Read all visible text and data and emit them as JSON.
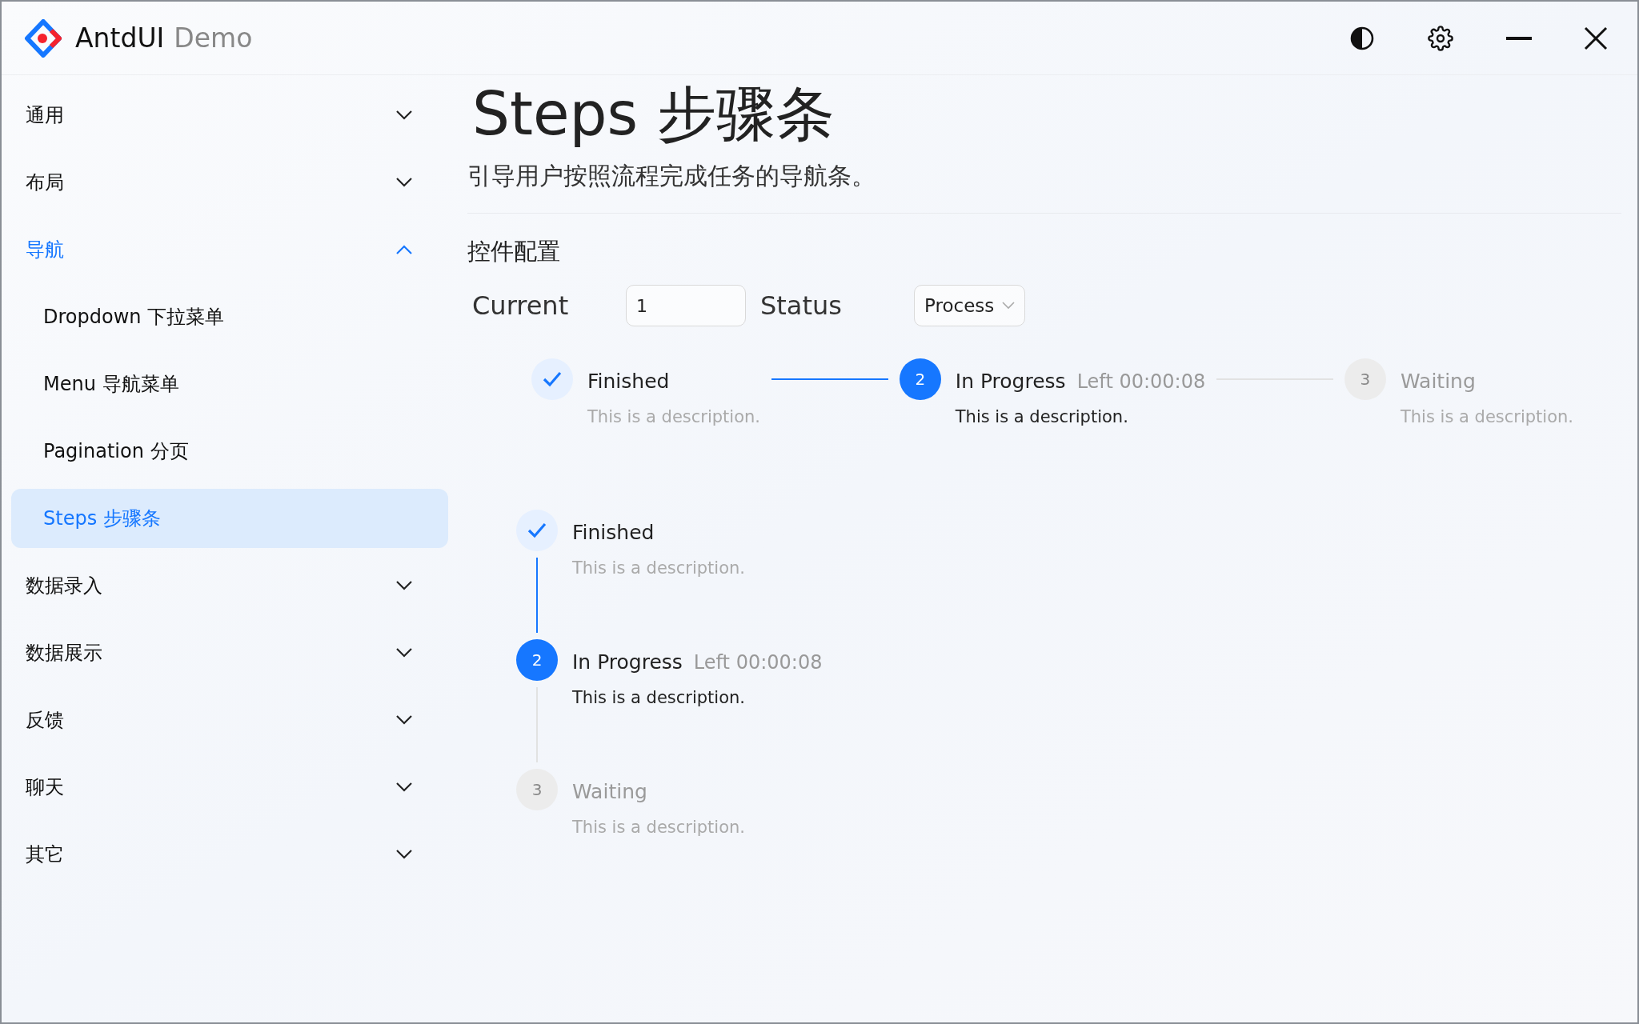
{
  "window": {
    "title": "AntdUI",
    "subtitle": "Demo"
  },
  "sidebar": {
    "items": [
      {
        "label": "通用",
        "expanded": false,
        "selected": false
      },
      {
        "label": "布局",
        "expanded": false,
        "selected": false
      },
      {
        "label": "导航",
        "expanded": true,
        "selected": true,
        "children": [
          {
            "label": "Dropdown 下拉菜单",
            "selected": false
          },
          {
            "label": "Menu 导航菜单",
            "selected": false
          },
          {
            "label": "Pagination 分页",
            "selected": false
          },
          {
            "label": "Steps 步骤条",
            "selected": true
          }
        ]
      },
      {
        "label": "数据录入",
        "expanded": false,
        "selected": false
      },
      {
        "label": "数据展示",
        "expanded": false,
        "selected": false
      },
      {
        "label": "反馈",
        "expanded": false,
        "selected": false
      },
      {
        "label": "聊天",
        "expanded": false,
        "selected": false
      },
      {
        "label": "其它",
        "expanded": false,
        "selected": false
      }
    ]
  },
  "page": {
    "title": "Steps 步骤条",
    "description": "引导用户按照流程完成任务的导航条。",
    "section": "控件配置",
    "current": {
      "label": "Current",
      "value": "1"
    },
    "status": {
      "label": "Status",
      "value": "Process"
    }
  },
  "steps_horizontal": [
    {
      "kind": "finish",
      "title": "Finished",
      "description": "This is a description."
    },
    {
      "kind": "process",
      "number": "2",
      "title": "In Progress",
      "subtitle": "Left 00:00:08",
      "description": "This is a description."
    },
    {
      "kind": "wait",
      "number": "3",
      "title": "Waiting",
      "description": "This is a description."
    }
  ],
  "steps_vertical": [
    {
      "kind": "finish",
      "title": "Finished",
      "description": "This is a description."
    },
    {
      "kind": "process",
      "number": "2",
      "title": "In Progress",
      "subtitle": "Left 00:00:08",
      "description": "This is a description."
    },
    {
      "kind": "wait",
      "number": "3",
      "title": "Waiting",
      "description": "This is a description."
    }
  ]
}
